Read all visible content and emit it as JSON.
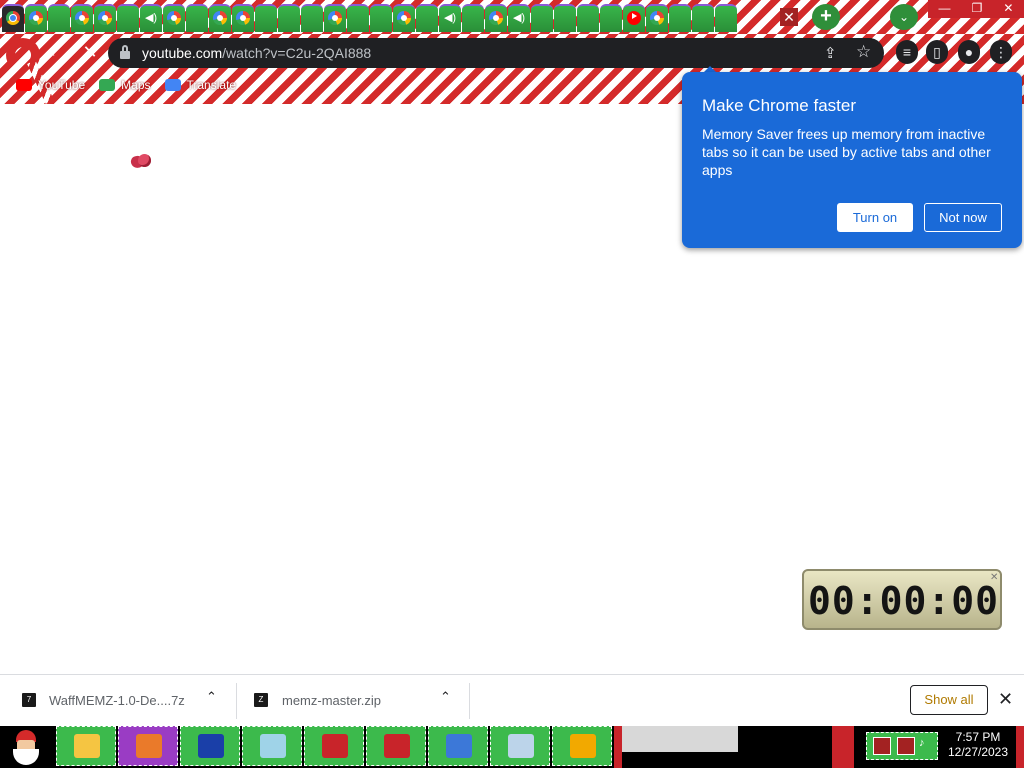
{
  "browser": {
    "tabs": [
      {
        "icon": "chrome-icon",
        "active": true
      },
      {
        "icon": "google-icon"
      },
      {
        "icon": "none"
      },
      {
        "icon": "google-icon"
      },
      {
        "icon": "google-icon"
      },
      {
        "icon": "none"
      },
      {
        "icon": "speaker-icon"
      },
      {
        "icon": "google-icon"
      },
      {
        "icon": "none"
      },
      {
        "icon": "google-icon"
      },
      {
        "icon": "google-icon"
      },
      {
        "icon": "none"
      },
      {
        "icon": "none"
      },
      {
        "icon": "none"
      },
      {
        "icon": "google-icon"
      },
      {
        "icon": "none"
      },
      {
        "icon": "none"
      },
      {
        "icon": "google-icon"
      },
      {
        "icon": "none"
      },
      {
        "icon": "speaker-icon"
      },
      {
        "icon": "none"
      },
      {
        "icon": "google-icon"
      },
      {
        "icon": "speaker-icon"
      },
      {
        "icon": "none"
      },
      {
        "icon": "none"
      },
      {
        "icon": "none"
      },
      {
        "icon": "none"
      },
      {
        "icon": "youtube-icon"
      },
      {
        "icon": "google-icon"
      },
      {
        "icon": "none"
      },
      {
        "icon": "none"
      },
      {
        "icon": "none"
      }
    ],
    "close_tab_glyph": "✕",
    "new_tab_glyph": "+",
    "tab_search_glyph": "⌄",
    "window_controls": [
      "—",
      "❐",
      "✕"
    ],
    "back_glyph": "←",
    "reload_glyph": "✕",
    "url": {
      "host": "youtube.com",
      "path": "/watch?v=C2u-2QAI888"
    },
    "share_glyph": "⇪",
    "star_glyph": "☆",
    "bookmarks": [
      {
        "label": "YouTube",
        "icon": "youtube-icon",
        "color": "#ff0000"
      },
      {
        "label": "Maps",
        "icon": "maps-icon",
        "color": "#34a853"
      },
      {
        "label": "Translate",
        "icon": "translate-icon",
        "color": "#4285f4"
      }
    ]
  },
  "memory_saver": {
    "title": "Make Chrome faster",
    "body": "Memory Saver frees up memory from inactive tabs so it can be used by active tabs and other apps",
    "turn_on_label": "Turn on",
    "not_now_label": "Not now",
    "accent": "#1a6ad8"
  },
  "timer": {
    "display": "00:00:00",
    "close_glyph": "✕"
  },
  "downloads": {
    "items": [
      {
        "name": "WaffMEMZ-1.0-De....7z",
        "icon": "7z-icon"
      },
      {
        "name": "memz-master.zip",
        "icon": "zip-icon"
      }
    ],
    "caret_glyph": "⌃",
    "show_all_label": "Show all",
    "close_glyph": "✕"
  },
  "taskbar": {
    "apps": [
      {
        "name": "explorer-icon",
        "color": "#f5c542"
      },
      {
        "name": "chrome-taskbar-icon",
        "color": "#ea7a2a",
        "purple": true
      },
      {
        "name": "sonic-icon",
        "color": "#1a3fa8"
      },
      {
        "name": "notepad-icon",
        "color": "#9fd3e8"
      },
      {
        "name": "toolbox-icon",
        "color": "#c8242a"
      },
      {
        "name": "toolbox-icon-2",
        "color": "#c8242a"
      },
      {
        "name": "wordpad-icon",
        "color": "#3c78d8"
      },
      {
        "name": "calculator-icon",
        "color": "#bcd4ea"
      },
      {
        "name": "windows-logo-icon",
        "color": "#f2a900"
      }
    ],
    "time": "7:57 PM",
    "date": "12/27/2023"
  }
}
